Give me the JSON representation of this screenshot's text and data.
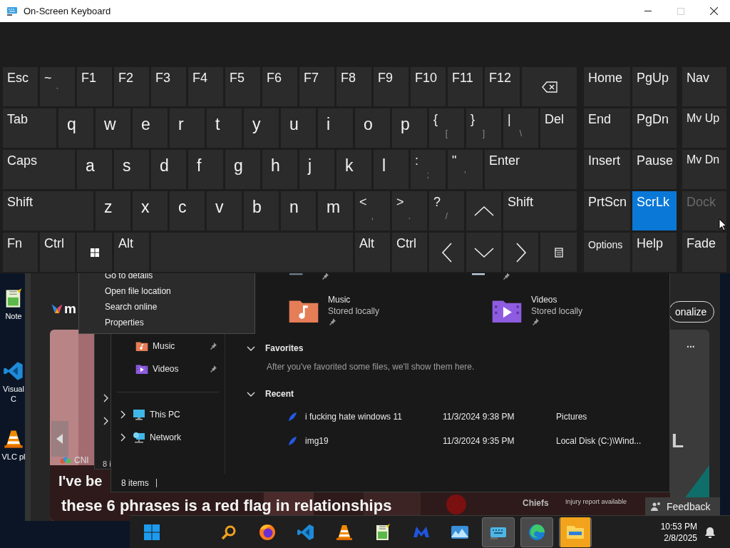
{
  "keyboard": {
    "title": "On-Screen Keyboard",
    "maximize_disabled": true,
    "rows": [
      [
        {
          "kind": "key",
          "label": "Esc"
        },
        {
          "kind": "key",
          "label": "~",
          "alt": "`"
        },
        {
          "kind": "key",
          "label": "F1"
        },
        {
          "kind": "key",
          "label": "F2"
        },
        {
          "kind": "key",
          "label": "F3"
        },
        {
          "kind": "key",
          "label": "F4"
        },
        {
          "kind": "key",
          "label": "F5"
        },
        {
          "kind": "key",
          "label": "F6"
        },
        {
          "kind": "key",
          "label": "F7"
        },
        {
          "kind": "key",
          "label": "F8"
        },
        {
          "kind": "key",
          "label": "F9"
        },
        {
          "kind": "key",
          "label": "F10"
        },
        {
          "kind": "key",
          "label": "F11"
        },
        {
          "kind": "key",
          "label": "F12"
        },
        {
          "kind": "backspace"
        }
      ],
      [
        {
          "kind": "key",
          "label": "Tab"
        },
        {
          "kind": "letter",
          "label": "q"
        },
        {
          "kind": "letter",
          "label": "w"
        },
        {
          "kind": "letter",
          "label": "e"
        },
        {
          "kind": "letter",
          "label": "r"
        },
        {
          "kind": "letter",
          "label": "t"
        },
        {
          "kind": "letter",
          "label": "y"
        },
        {
          "kind": "letter",
          "label": "u"
        },
        {
          "kind": "letter",
          "label": "i"
        },
        {
          "kind": "letter",
          "label": "o"
        },
        {
          "kind": "letter",
          "label": "p"
        },
        {
          "kind": "key",
          "label": "{",
          "alt": "["
        },
        {
          "kind": "key",
          "label": "}",
          "alt": "]"
        },
        {
          "kind": "key",
          "label": "|",
          "alt": "\\"
        },
        {
          "kind": "key",
          "label": "Del"
        }
      ],
      [
        {
          "kind": "key",
          "label": "Caps"
        },
        {
          "kind": "letter",
          "label": "a"
        },
        {
          "kind": "letter",
          "label": "s"
        },
        {
          "kind": "letter",
          "label": "d"
        },
        {
          "kind": "letter",
          "label": "f"
        },
        {
          "kind": "letter",
          "label": "g"
        },
        {
          "kind": "letter",
          "label": "h"
        },
        {
          "kind": "letter",
          "label": "j"
        },
        {
          "kind": "letter",
          "label": "k"
        },
        {
          "kind": "letter",
          "label": "l"
        },
        {
          "kind": "key",
          "label": ":",
          "alt": ";"
        },
        {
          "kind": "key",
          "label": "\"",
          "alt": "'"
        },
        {
          "kind": "key",
          "label": "Enter"
        }
      ],
      [
        {
          "kind": "key",
          "label": "Shift"
        },
        {
          "kind": "letter",
          "label": "z"
        },
        {
          "kind": "letter",
          "label": "x"
        },
        {
          "kind": "letter",
          "label": "c"
        },
        {
          "kind": "letter",
          "label": "v"
        },
        {
          "kind": "letter",
          "label": "b"
        },
        {
          "kind": "letter",
          "label": "n"
        },
        {
          "kind": "letter",
          "label": "m"
        },
        {
          "kind": "key",
          "label": "<",
          "alt": ","
        },
        {
          "kind": "key",
          "label": ">",
          "alt": "."
        },
        {
          "kind": "key",
          "label": "?",
          "alt": "/"
        },
        {
          "kind": "up"
        },
        {
          "kind": "key",
          "label": "Shift"
        }
      ],
      [
        {
          "kind": "key",
          "label": "Fn"
        },
        {
          "kind": "key",
          "label": "Ctrl"
        },
        {
          "kind": "windows"
        },
        {
          "kind": "key",
          "label": "Alt"
        },
        {
          "kind": "space"
        },
        {
          "kind": "key",
          "label": "Alt"
        },
        {
          "kind": "key",
          "label": "Ctrl"
        },
        {
          "kind": "left"
        },
        {
          "kind": "down"
        },
        {
          "kind": "right"
        },
        {
          "kind": "menu"
        }
      ]
    ],
    "nav_rows": [
      [
        {
          "kind": "key",
          "label": "Home",
          "selected": false,
          "disabled": false
        },
        {
          "kind": "key",
          "label": "PgUp",
          "selected": false,
          "disabled": false
        },
        {
          "kind": "key",
          "label": "Nav",
          "selected": false,
          "disabled": false
        }
      ],
      [
        {
          "kind": "key",
          "label": "End",
          "selected": false,
          "disabled": false
        },
        {
          "kind": "key",
          "label": "PgDn",
          "selected": false,
          "disabled": false
        },
        {
          "kind": "small",
          "label": "Mv Up",
          "selected": false,
          "disabled": false
        }
      ],
      [
        {
          "kind": "key",
          "label": "Insert",
          "selected": false,
          "disabled": false
        },
        {
          "kind": "key",
          "label": "Pause",
          "selected": false,
          "disabled": false
        },
        {
          "kind": "small",
          "label": "Mv Dn",
          "selected": false,
          "disabled": false
        }
      ],
      [
        {
          "kind": "key",
          "label": "PrtScn",
          "selected": false,
          "disabled": false
        },
        {
          "kind": "key",
          "label": "ScrLk",
          "selected": true,
          "disabled": false
        },
        {
          "kind": "key",
          "label": "Dock",
          "selected": false,
          "disabled": true
        }
      ],
      [
        {
          "kind": "tiny",
          "label": "Options",
          "selected": false,
          "disabled": false
        },
        {
          "kind": "key",
          "label": "Help",
          "selected": false,
          "disabled": false
        },
        {
          "kind": "key",
          "label": "Fade",
          "selected": false,
          "disabled": false
        }
      ]
    ]
  },
  "desktop_icons": [
    {
      "kind": "notepad",
      "label": "Note"
    },
    {
      "kind": "code",
      "label": "Visual C"
    },
    {
      "kind": "cone",
      "label": "VLC pl"
    }
  ],
  "widgets": {
    "brand": "m",
    "personalize": "onalize",
    "more": "...",
    "source": "CNI",
    "headline_1": "I've be",
    "headline_2": "these 6 phrases is a red flag in relationships",
    "side_text": "L",
    "team": "Chiefs",
    "note": "Injury report available",
    "feedback": "Feedback"
  },
  "back_window": {
    "status": "8 i"
  },
  "context_menu": {
    "items": [
      "Go to details",
      "Open file location",
      "Search online",
      "Properties"
    ]
  },
  "explorer": {
    "quick_access": [
      {
        "kind": "music",
        "label": "Music",
        "pinned": true
      },
      {
        "kind": "videos",
        "label": "Videos",
        "pinned": true
      }
    ],
    "locations": [
      {
        "kind": "pc",
        "label": "This PC",
        "expanded": false
      },
      {
        "kind": "network",
        "label": "Network",
        "expanded": false
      }
    ],
    "tiles": [
      {
        "kind": "music",
        "name": "Music",
        "subtitle": "Stored locally",
        "pinned": true
      },
      {
        "kind": "videos",
        "name": "Videos",
        "subtitle": "Stored locally",
        "pinned": true
      }
    ],
    "sections": [
      {
        "title": "Favorites",
        "expanded": true,
        "message": "After you've favorited some files, we'll show them here."
      },
      {
        "title": "Recent",
        "expanded": true
      }
    ],
    "recent": [
      {
        "name": "i fucking hate windows 11",
        "modified": "11/3/2024 9:38 PM",
        "location": "Pictures"
      },
      {
        "name": "img19",
        "modified": "11/3/2024 9:35 PM",
        "location": "Local Disk (C:)\\Wind..."
      }
    ],
    "status": "8 items"
  },
  "taskbar": {
    "items": [
      {
        "kind": "start",
        "active": false
      },
      {
        "kind": "search",
        "active": false
      },
      {
        "kind": "globe",
        "active": false
      },
      {
        "kind": "code",
        "active": false
      },
      {
        "kind": "cone",
        "active": false
      },
      {
        "kind": "notepad",
        "active": false
      },
      {
        "kind": "wave",
        "active": false
      },
      {
        "kind": "landscape",
        "active": false
      },
      {
        "kind": "keyboard",
        "active": true
      },
      {
        "kind": "swirl",
        "active": true
      },
      {
        "kind": "folder",
        "active": true
      }
    ],
    "time": "10:53 PM",
    "date": "2/8/2025"
  }
}
